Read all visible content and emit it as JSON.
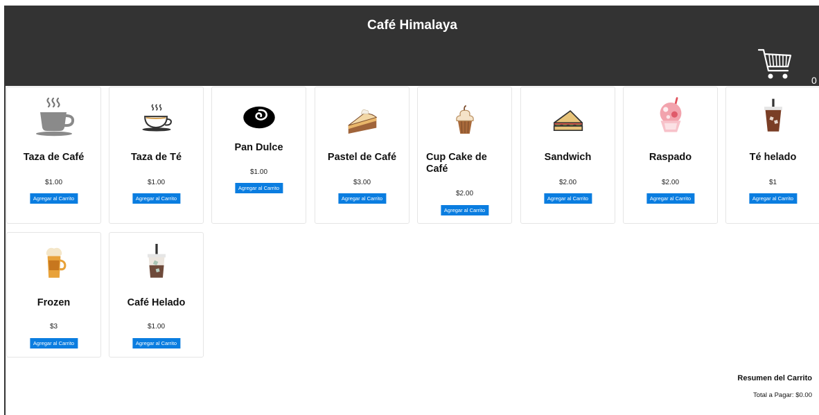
{
  "store": {
    "title": "Café Himalaya",
    "cart_count": "0"
  },
  "products": [
    {
      "name": "Taza de Café",
      "price": "$1.00",
      "button": "Agregar al Carrito",
      "icon": "coffee-cup-icon"
    },
    {
      "name": "Taza de Té",
      "price": "$1.00",
      "button": "Agregar al Carrito",
      "icon": "tea-cup-icon"
    },
    {
      "name": "Pan Dulce",
      "price": "$1.00",
      "button": "Agregar al Carrito",
      "icon": "cinnamon-roll-icon"
    },
    {
      "name": "Pastel de Café",
      "price": "$3.00",
      "button": "Agregar al Carrito",
      "icon": "cake-slice-icon"
    },
    {
      "name": "Cup Cake de Café",
      "price": "$2.00",
      "button": "Agregar al Carrito",
      "icon": "cupcake-icon"
    },
    {
      "name": "Sandwich",
      "price": "$2.00",
      "button": "Agregar al Carrito",
      "icon": "sandwich-icon"
    },
    {
      "name": "Raspado",
      "price": "$2.00",
      "button": "Agregar al Carrito",
      "icon": "shaved-ice-icon"
    },
    {
      "name": "Té helado",
      "price": "$1",
      "button": "Agregar al Carrito",
      "icon": "iced-tea-icon"
    },
    {
      "name": "Frozen",
      "price": "$3",
      "button": "Agregar al Carrito",
      "icon": "frozen-drink-icon"
    },
    {
      "name": "Café Helado",
      "price": "$1.00",
      "button": "Agregar al Carrito",
      "icon": "iced-coffee-icon"
    }
  ],
  "summary": {
    "title": "Resumen del Carrito",
    "total": "Total a Pagar: $0.00"
  },
  "colors": {
    "header_bg": "#333333",
    "button_bg": "#0a7de0"
  }
}
